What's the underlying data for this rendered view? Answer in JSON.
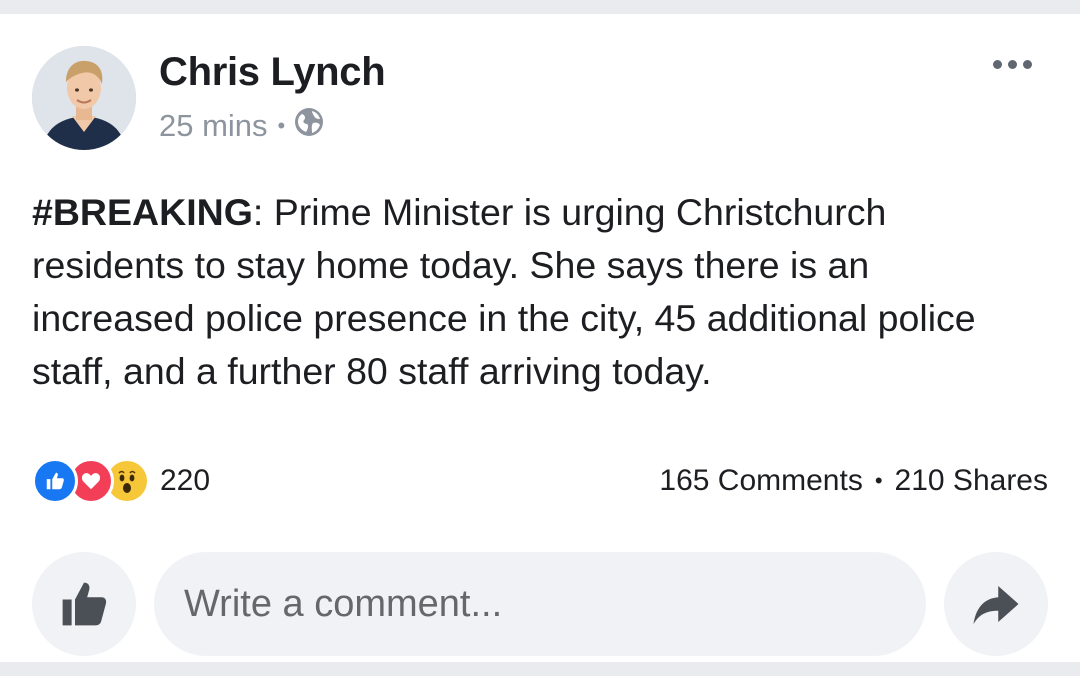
{
  "post": {
    "author": "Chris Lynch",
    "time": "25 mins",
    "separator": "•",
    "privacy_icon": "globe-icon",
    "menu_icon": "more-options-icon",
    "hashtag": "#BREAKING",
    "body": ": Prime Minister is urging Christchurch residents to stay home today. She says there is an increased police presence in the city, 45 additional police staff, and a further 80 staff arriving today."
  },
  "reactions": {
    "icons": [
      "like-reaction-icon",
      "love-reaction-icon",
      "wow-reaction-icon"
    ],
    "count": "220"
  },
  "stats": {
    "comments": "165 Comments",
    "separator": "•",
    "shares": "210 Shares"
  },
  "composer": {
    "placeholder": "Write a comment...",
    "like_icon": "thumbs-up-icon",
    "share_icon": "share-arrow-icon"
  },
  "colors": {
    "like_blue": "#1877f2",
    "love_red": "#f33e58",
    "wow_yellow": "#f7c73a",
    "meta_gray": "#8d949e",
    "button_bg": "#f0f2f5"
  }
}
